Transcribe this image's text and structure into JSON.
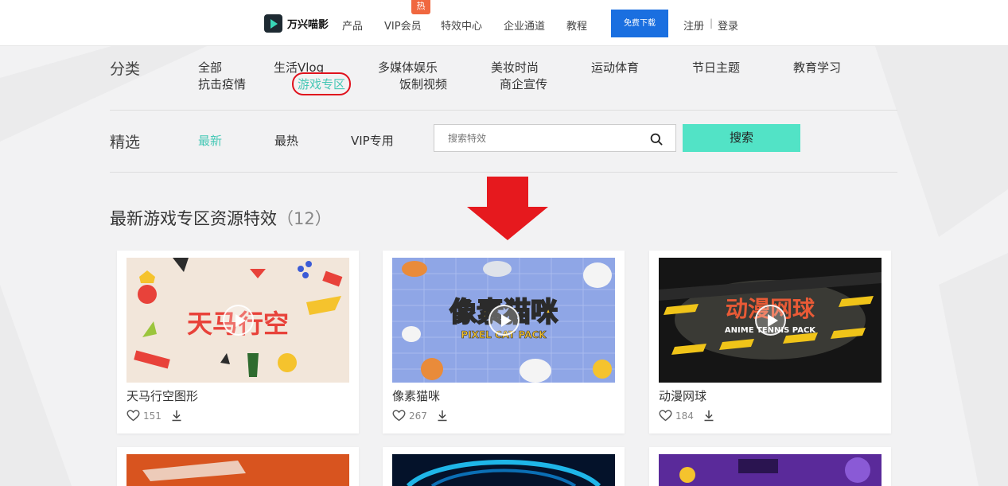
{
  "nav": {
    "logo": "万兴喵影",
    "items": [
      {
        "id": "product",
        "label": "产品"
      },
      {
        "id": "vip",
        "label": "VIP会员"
      },
      {
        "id": "effects",
        "label": "特效中心"
      },
      {
        "id": "enterprise",
        "label": "企业通道"
      },
      {
        "id": "tutorial",
        "label": "教程"
      }
    ],
    "hot_badge": "热",
    "download": "免费下载",
    "register": "注册",
    "separator": "|",
    "login": "登录"
  },
  "filters": {
    "category_label": "分类",
    "categories": [
      {
        "label": "全部",
        "active": false
      },
      {
        "label": "生活Vlog",
        "active": false
      },
      {
        "label": "多媒体娱乐",
        "active": false
      },
      {
        "label": "美妆时尚",
        "active": false
      },
      {
        "label": "运动体育",
        "active": false
      },
      {
        "label": "节日主题",
        "active": false
      },
      {
        "label": "教育学习",
        "active": false
      },
      {
        "label": "抗击疫情",
        "active": false
      },
      {
        "label": "游戏专区",
        "active": true
      },
      {
        "label": "饭制视频",
        "active": false
      },
      {
        "label": "商企宣传",
        "active": false
      }
    ],
    "pick_label": "精选",
    "sorts": [
      {
        "label": "最新",
        "active": true
      },
      {
        "label": "最热",
        "active": false
      },
      {
        "label": "VIP专用",
        "active": false
      }
    ],
    "search_placeholder": "搜索特效",
    "search_button": "搜索"
  },
  "results": {
    "title": "最新游戏专区资源特效",
    "count": "（12）"
  },
  "cards": [
    {
      "title": "天马行空图形",
      "likes": "151",
      "thumb_text": "天马行空"
    },
    {
      "title": "像素猫咪",
      "likes": "267",
      "thumb_text": "像素猫咪",
      "thumb_sub": "PIXEL CAT PACK"
    },
    {
      "title": "动漫网球",
      "likes": "184",
      "thumb_text": "动漫网球",
      "thumb_sub": "ANIME TENNIS PACK"
    }
  ],
  "colors": {
    "accent": "#47c8b6",
    "search_button": "#52e3c6",
    "download_button": "#1a6fe0",
    "hot_badge": "#f0673f",
    "annotation_red": "#e0121d"
  }
}
